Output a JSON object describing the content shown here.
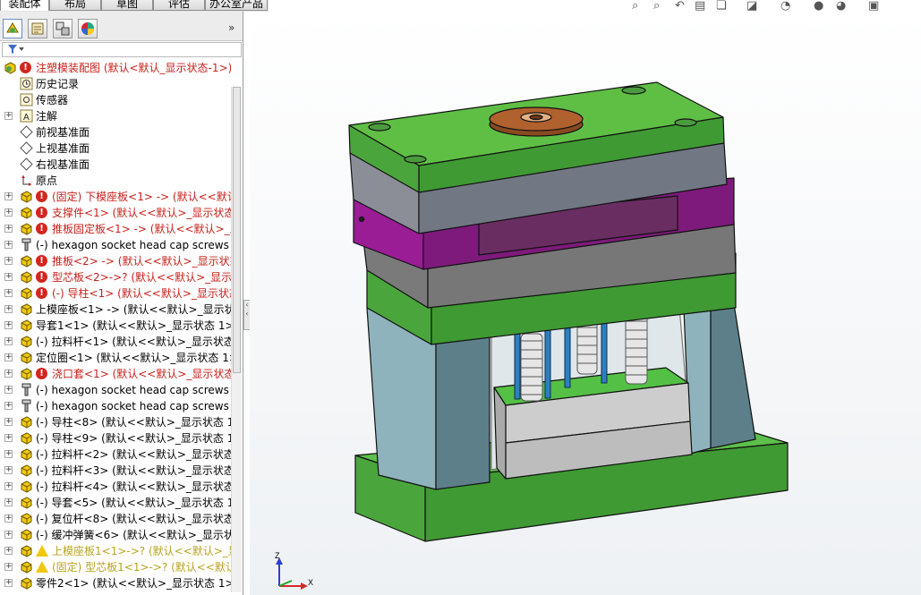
{
  "tabs": [
    {
      "label": "装配体",
      "active": true
    },
    {
      "label": "布局",
      "active": false
    },
    {
      "label": "草图",
      "active": false
    },
    {
      "label": "评估",
      "active": false
    },
    {
      "label": "办公室产品",
      "active": false
    }
  ],
  "panel_toolbar": {
    "icons": [
      "feature-manager-icon",
      "property-manager-icon",
      "configuration-manager-icon",
      "display-manager-icon"
    ],
    "expand_glyph": "»"
  },
  "filter": {
    "icon": "filter-icon",
    "glyph": "▼"
  },
  "tree": {
    "root": {
      "label": "注塑模装配图  (默认<默认_显示状态-1>)",
      "status": "error"
    },
    "items": [
      {
        "label": "历史记录",
        "icon": "history-icon",
        "status": "none",
        "expandable": false,
        "tone": "normal"
      },
      {
        "label": "传感器",
        "icon": "sensor-icon",
        "status": "none",
        "expandable": false,
        "tone": "normal"
      },
      {
        "label": "注解",
        "icon": "annotation-icon",
        "status": "none",
        "expandable": true,
        "tone": "normal"
      },
      {
        "label": "前视基准面",
        "icon": "plane-icon",
        "status": "none",
        "expandable": false,
        "tone": "normal"
      },
      {
        "label": "上视基准面",
        "icon": "plane-icon",
        "status": "none",
        "expandable": false,
        "tone": "normal"
      },
      {
        "label": "右视基准面",
        "icon": "plane-icon",
        "status": "none",
        "expandable": false,
        "tone": "normal"
      },
      {
        "label": "原点",
        "icon": "origin-icon",
        "status": "none",
        "expandable": false,
        "tone": "normal"
      },
      {
        "label": "(固定) 下模座板<1> -> (默认<<默认",
        "icon": "part-icon",
        "status": "error",
        "expandable": true,
        "tone": "error"
      },
      {
        "label": "支撑件<1> (默认<<默认>_显示状态",
        "icon": "part-icon",
        "status": "error",
        "expandable": true,
        "tone": "error"
      },
      {
        "label": "推板固定板<1> -> (默认<<默认>_显",
        "icon": "part-icon",
        "status": "error",
        "expandable": true,
        "tone": "error"
      },
      {
        "label": "(-) hexagon socket head cap screws",
        "icon": "screw-icon",
        "status": "none",
        "expandable": true,
        "tone": "normal"
      },
      {
        "label": "推板<2> -> (默认<<默认>_显示状态",
        "icon": "part-icon",
        "status": "error",
        "expandable": true,
        "tone": "error"
      },
      {
        "label": "型芯板<2>->? (默认<<默认>_显示状",
        "icon": "part-icon",
        "status": "error",
        "expandable": true,
        "tone": "error"
      },
      {
        "label": "(-) 导柱<1> (默认<<默认>_显示状态",
        "icon": "part-icon",
        "status": "error",
        "expandable": true,
        "tone": "error"
      },
      {
        "label": "上模座板<1> -> (默认<<默认>_显示状",
        "icon": "part-icon",
        "status": "none",
        "expandable": true,
        "tone": "normal"
      },
      {
        "label": "导套1<1> (默认<<默认>_显示状态 1>)",
        "icon": "part-icon",
        "status": "none",
        "expandable": true,
        "tone": "normal"
      },
      {
        "label": "(-) 拉料杆<1> (默认<<默认>_显示状态",
        "icon": "part-icon",
        "status": "none",
        "expandable": true,
        "tone": "normal"
      },
      {
        "label": "定位圈<1> (默认<<默认>_显示状态 1>",
        "icon": "part-icon",
        "status": "none",
        "expandable": true,
        "tone": "normal"
      },
      {
        "label": "浇口套<1> (默认<<默认>_显示状态",
        "icon": "part-icon",
        "status": "error",
        "expandable": true,
        "tone": "error"
      },
      {
        "label": "(-) hexagon socket head cap screws",
        "icon": "screw-icon",
        "status": "none",
        "expandable": true,
        "tone": "normal"
      },
      {
        "label": "(-) hexagon socket head cap screws",
        "icon": "screw-icon",
        "status": "none",
        "expandable": true,
        "tone": "normal"
      },
      {
        "label": "(-) 导柱<8> (默认<<默认>_显示状态 1",
        "icon": "part-icon",
        "status": "none",
        "expandable": true,
        "tone": "normal"
      },
      {
        "label": "(-) 导柱<9> (默认<<默认>_显示状态 1",
        "icon": "part-icon",
        "status": "none",
        "expandable": true,
        "tone": "normal"
      },
      {
        "label": "(-) 拉料杆<2> (默认<<默认>_显示状态",
        "icon": "part-icon",
        "status": "none",
        "expandable": true,
        "tone": "normal"
      },
      {
        "label": "(-) 拉料杆<3> (默认<<默认>_显示状态",
        "icon": "part-icon",
        "status": "none",
        "expandable": true,
        "tone": "normal"
      },
      {
        "label": "(-) 拉料杆<4> (默认<<默认>_显示状态",
        "icon": "part-icon",
        "status": "none",
        "expandable": true,
        "tone": "normal"
      },
      {
        "label": "(-) 导套<5> (默认<<默认>_显示状态 1",
        "icon": "part-icon",
        "status": "none",
        "expandable": true,
        "tone": "normal"
      },
      {
        "label": "(-) 复位杆<8> (默认<<默认>_显示状态",
        "icon": "part-icon",
        "status": "none",
        "expandable": true,
        "tone": "normal"
      },
      {
        "label": "(-) 缓冲弹簧<6> (默认<<默认>_显示状",
        "icon": "part-icon",
        "status": "none",
        "expandable": true,
        "tone": "normal"
      },
      {
        "label": "上模座板1<1>->? (默认<<默认>_显",
        "icon": "part-icon",
        "status": "warning",
        "expandable": true,
        "tone": "warning"
      },
      {
        "label": "(固定) 型芯板1<1>->? (默认<<默认>",
        "icon": "part-icon",
        "status": "warning",
        "expandable": true,
        "tone": "warning"
      },
      {
        "label": "零件2<1> (默认<<默认>_显示状态 1>)",
        "icon": "part-icon",
        "status": "none",
        "expandable": true,
        "tone": "normal"
      }
    ]
  },
  "view_toolbar": {
    "icons": [
      "zoom-to-fit-icon",
      "zoom-to-area-icon",
      "previous-view-icon",
      "section-view-icon",
      "view-orientation-icon",
      "display-style-icon",
      "hide-show-icon",
      "appearance-icon",
      "scene-icon",
      "view-settings-icon"
    ]
  },
  "triad": {
    "z_label": "Z",
    "x_label": "X"
  },
  "colors": {
    "error": "#c8201a",
    "warning": "#b8a31e",
    "plate_green": "#5fbf45",
    "plate_grey": "#8f929a",
    "plate_purple": "#8a1e87",
    "support_teal": "#7ea1ad",
    "insert_grey": "#c9c9c9",
    "pin_blue": "#2d7fc0",
    "flange_brown": "#a05a2c"
  }
}
